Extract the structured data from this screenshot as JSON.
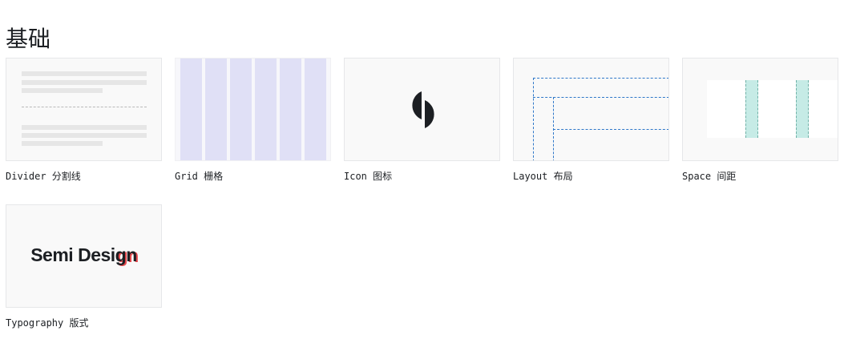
{
  "section": {
    "title": "基础"
  },
  "cards": [
    {
      "key": "divider",
      "label": "Divider 分割线"
    },
    {
      "key": "grid",
      "label": "Grid 栅格"
    },
    {
      "key": "icon",
      "label": "Icon 图标",
      "icon": "semi-logo-icon"
    },
    {
      "key": "layout",
      "label": "Layout 布局"
    },
    {
      "key": "space",
      "label": "Space 间距"
    },
    {
      "key": "typography",
      "label": "Typography 版式",
      "preview": {
        "text_main": "Semi Desi",
        "text_accent": "gn"
      }
    }
  ],
  "colors": {
    "text": "#1c1f23",
    "thumb_bg": "#f9f9f9",
    "grid_column": "#e0e0f6",
    "layout_dash": "#2f78c9",
    "space_accent": "#c6ebe6",
    "typography_accent": "#e5484d"
  }
}
